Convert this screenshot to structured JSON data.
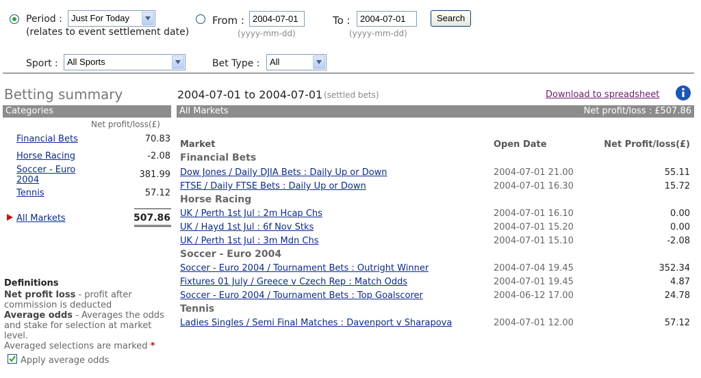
{
  "filters": {
    "period_label": "Period :",
    "period_value": "Just For Today",
    "period_note": "(relates to event settlement date)",
    "from_label": "From :",
    "from_value": "2004-07-01",
    "from_hint": "(yyyy-mm-dd)",
    "to_label": "To :",
    "to_value": "2004-07-01",
    "to_hint": "(yyyy-mm-dd)",
    "search_label": "Search",
    "sport_label": "Sport :",
    "sport_value": "All Sports",
    "bettype_label": "Bet Type :",
    "bettype_value": "All"
  },
  "sidebar": {
    "title": "Betting summary",
    "categories_header": "Categories",
    "net_header": "Net profit/loss(£)",
    "items": [
      {
        "label": "Financial Bets",
        "value": "70.83"
      },
      {
        "label": "Horse Racing",
        "value": "-2.08"
      },
      {
        "label": "Soccer - Euro 2004",
        "value": "381.99"
      },
      {
        "label": "Tennis",
        "value": "57.12"
      }
    ],
    "all_label": "All Markets",
    "all_value": "507.86"
  },
  "definitions": {
    "title": "Definitions",
    "npl_term": "Net profit loss",
    "npl_text": " - profit after commission is deducted",
    "avg_term": "Average odds",
    "avg_text": " - Averages the odds and stake for selection at market level.",
    "marked_text": "Averaged selections are marked ",
    "marked_star": "*",
    "apply_label": "Apply average odds"
  },
  "main": {
    "date_range": "2004-07-01 to 2004-07-01",
    "settled_note": "(settled bets)",
    "download_label": "Download to spreadsheet",
    "bar_label": "All Markets",
    "bar_net": "Net profit/loss : £507.86",
    "col_market": "Market",
    "col_date": "Open Date",
    "col_net": "Net Profit/loss(£)",
    "groups": [
      {
        "name": "Financial Bets",
        "rows": [
          {
            "market": "Dow Jones / Daily DJIA Bets : Daily Up or Down",
            "date": "2004-07-01 21.00",
            "net": "55.11"
          },
          {
            "market": "FTSE / Daily FTSE Bets : Daily Up or Down",
            "date": "2004-07-01 16.30",
            "net": "15.72"
          }
        ]
      },
      {
        "name": "Horse Racing",
        "rows": [
          {
            "market": "UK / Perth 1st Jul : 2m Hcap Chs",
            "date": "2004-07-01 16.10",
            "net": "0.00"
          },
          {
            "market": "UK / Hayd 1st Jul : 6f Nov Stks",
            "date": "2004-07-01 15.20",
            "net": "0.00"
          },
          {
            "market": "UK / Perth 1st Jul : 3m Mdn Chs",
            "date": "2004-07-01 15.10",
            "net": "-2.08"
          }
        ]
      },
      {
        "name": "Soccer - Euro 2004",
        "rows": [
          {
            "market": "Soccer - Euro 2004 / Tournament Bets : Outright Winner",
            "date": "2004-07-04 19.45",
            "net": "352.34"
          },
          {
            "market": "Fixtures 01 July / Greece v Czech Rep : Match Odds",
            "date": "2004-07-01 19.45",
            "net": "4.87"
          },
          {
            "market": "Soccer - Euro 2004 / Tournament Bets : Top Goalscorer",
            "date": "2004-06-12 17.00",
            "net": "24.78"
          }
        ]
      },
      {
        "name": "Tennis",
        "rows": [
          {
            "market": "Ladies Singles / Semi Final Matches : Davenport v Sharapova",
            "date": "2004-07-01 12.00",
            "net": "57.12"
          }
        ]
      }
    ]
  },
  "colors": {
    "bar": "#8c8c8c",
    "link": "#0b2a8a",
    "download_link": "#6a1b6a",
    "info": "#1a56b8",
    "arrow": "#cc1111"
  }
}
